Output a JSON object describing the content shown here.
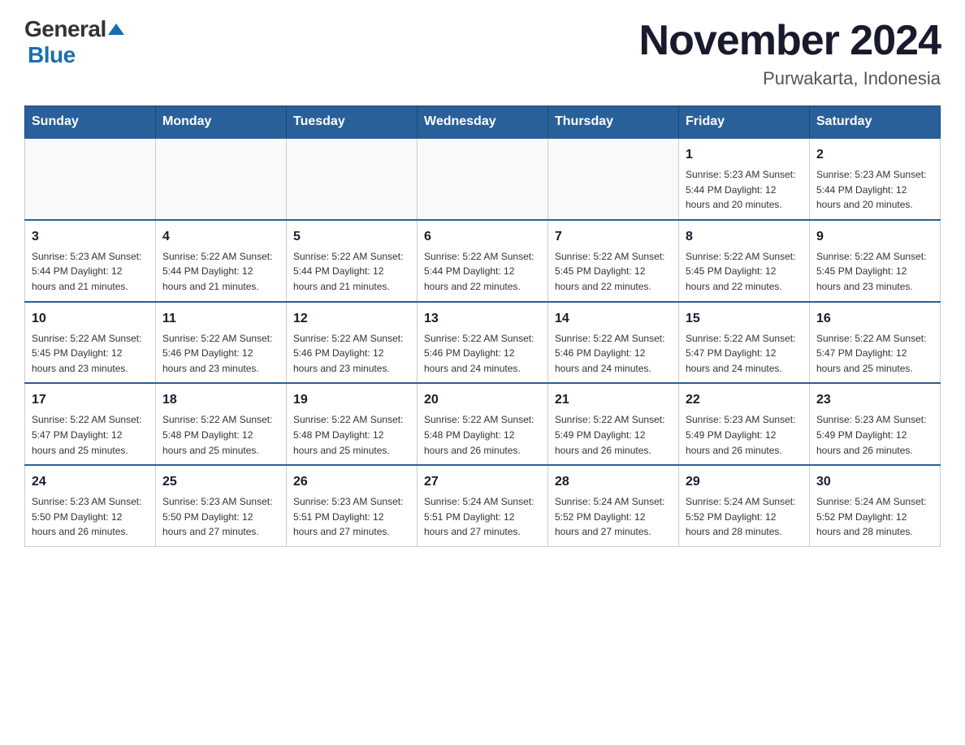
{
  "header": {
    "logo_general": "General",
    "logo_blue": "Blue",
    "month_title": "November 2024",
    "location": "Purwakarta, Indonesia"
  },
  "days_of_week": [
    "Sunday",
    "Monday",
    "Tuesday",
    "Wednesday",
    "Thursday",
    "Friday",
    "Saturday"
  ],
  "weeks": [
    [
      {
        "day": "",
        "info": ""
      },
      {
        "day": "",
        "info": ""
      },
      {
        "day": "",
        "info": ""
      },
      {
        "day": "",
        "info": ""
      },
      {
        "day": "",
        "info": ""
      },
      {
        "day": "1",
        "info": "Sunrise: 5:23 AM\nSunset: 5:44 PM\nDaylight: 12 hours and 20 minutes."
      },
      {
        "day": "2",
        "info": "Sunrise: 5:23 AM\nSunset: 5:44 PM\nDaylight: 12 hours and 20 minutes."
      }
    ],
    [
      {
        "day": "3",
        "info": "Sunrise: 5:23 AM\nSunset: 5:44 PM\nDaylight: 12 hours and 21 minutes."
      },
      {
        "day": "4",
        "info": "Sunrise: 5:22 AM\nSunset: 5:44 PM\nDaylight: 12 hours and 21 minutes."
      },
      {
        "day": "5",
        "info": "Sunrise: 5:22 AM\nSunset: 5:44 PM\nDaylight: 12 hours and 21 minutes."
      },
      {
        "day": "6",
        "info": "Sunrise: 5:22 AM\nSunset: 5:44 PM\nDaylight: 12 hours and 22 minutes."
      },
      {
        "day": "7",
        "info": "Sunrise: 5:22 AM\nSunset: 5:45 PM\nDaylight: 12 hours and 22 minutes."
      },
      {
        "day": "8",
        "info": "Sunrise: 5:22 AM\nSunset: 5:45 PM\nDaylight: 12 hours and 22 minutes."
      },
      {
        "day": "9",
        "info": "Sunrise: 5:22 AM\nSunset: 5:45 PM\nDaylight: 12 hours and 23 minutes."
      }
    ],
    [
      {
        "day": "10",
        "info": "Sunrise: 5:22 AM\nSunset: 5:45 PM\nDaylight: 12 hours and 23 minutes."
      },
      {
        "day": "11",
        "info": "Sunrise: 5:22 AM\nSunset: 5:46 PM\nDaylight: 12 hours and 23 minutes."
      },
      {
        "day": "12",
        "info": "Sunrise: 5:22 AM\nSunset: 5:46 PM\nDaylight: 12 hours and 23 minutes."
      },
      {
        "day": "13",
        "info": "Sunrise: 5:22 AM\nSunset: 5:46 PM\nDaylight: 12 hours and 24 minutes."
      },
      {
        "day": "14",
        "info": "Sunrise: 5:22 AM\nSunset: 5:46 PM\nDaylight: 12 hours and 24 minutes."
      },
      {
        "day": "15",
        "info": "Sunrise: 5:22 AM\nSunset: 5:47 PM\nDaylight: 12 hours and 24 minutes."
      },
      {
        "day": "16",
        "info": "Sunrise: 5:22 AM\nSunset: 5:47 PM\nDaylight: 12 hours and 25 minutes."
      }
    ],
    [
      {
        "day": "17",
        "info": "Sunrise: 5:22 AM\nSunset: 5:47 PM\nDaylight: 12 hours and 25 minutes."
      },
      {
        "day": "18",
        "info": "Sunrise: 5:22 AM\nSunset: 5:48 PM\nDaylight: 12 hours and 25 minutes."
      },
      {
        "day": "19",
        "info": "Sunrise: 5:22 AM\nSunset: 5:48 PM\nDaylight: 12 hours and 25 minutes."
      },
      {
        "day": "20",
        "info": "Sunrise: 5:22 AM\nSunset: 5:48 PM\nDaylight: 12 hours and 26 minutes."
      },
      {
        "day": "21",
        "info": "Sunrise: 5:22 AM\nSunset: 5:49 PM\nDaylight: 12 hours and 26 minutes."
      },
      {
        "day": "22",
        "info": "Sunrise: 5:23 AM\nSunset: 5:49 PM\nDaylight: 12 hours and 26 minutes."
      },
      {
        "day": "23",
        "info": "Sunrise: 5:23 AM\nSunset: 5:49 PM\nDaylight: 12 hours and 26 minutes."
      }
    ],
    [
      {
        "day": "24",
        "info": "Sunrise: 5:23 AM\nSunset: 5:50 PM\nDaylight: 12 hours and 26 minutes."
      },
      {
        "day": "25",
        "info": "Sunrise: 5:23 AM\nSunset: 5:50 PM\nDaylight: 12 hours and 27 minutes."
      },
      {
        "day": "26",
        "info": "Sunrise: 5:23 AM\nSunset: 5:51 PM\nDaylight: 12 hours and 27 minutes."
      },
      {
        "day": "27",
        "info": "Sunrise: 5:24 AM\nSunset: 5:51 PM\nDaylight: 12 hours and 27 minutes."
      },
      {
        "day": "28",
        "info": "Sunrise: 5:24 AM\nSunset: 5:52 PM\nDaylight: 12 hours and 27 minutes."
      },
      {
        "day": "29",
        "info": "Sunrise: 5:24 AM\nSunset: 5:52 PM\nDaylight: 12 hours and 28 minutes."
      },
      {
        "day": "30",
        "info": "Sunrise: 5:24 AM\nSunset: 5:52 PM\nDaylight: 12 hours and 28 minutes."
      }
    ]
  ]
}
